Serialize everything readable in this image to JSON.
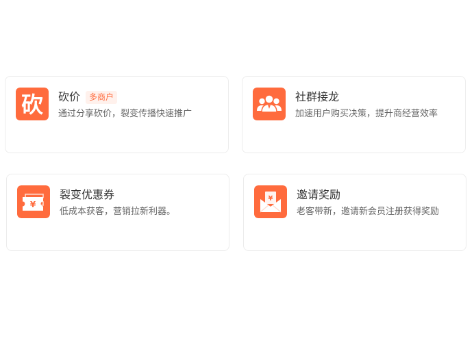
{
  "colors": {
    "accent": "#FF6B3D",
    "tag_bg": "#FFF1EC",
    "tag_text": "#FF6B3D",
    "title": "#333333",
    "desc": "#666666",
    "card_border": "#ECECEC"
  },
  "cards": [
    {
      "title": "砍价",
      "tag": "多商户",
      "desc": "通过分享砍价，裂变传播快速推广",
      "icon": "kan-character-icon",
      "icon_char": "砍"
    },
    {
      "title": "社群接龙",
      "desc": "加速用户购买决策，提升商经营效率",
      "icon": "group-users-icon"
    },
    {
      "title": "裂变优惠券",
      "desc": "低成本获客，营销拉新利器。",
      "icon": "coupon-ticket-icon",
      "icon_symbol": "¥"
    },
    {
      "title": "邀请奖励",
      "desc": "老客带新，邀请新会员注册获得奖励",
      "icon": "red-envelope-icon",
      "icon_symbol": "¥"
    }
  ]
}
